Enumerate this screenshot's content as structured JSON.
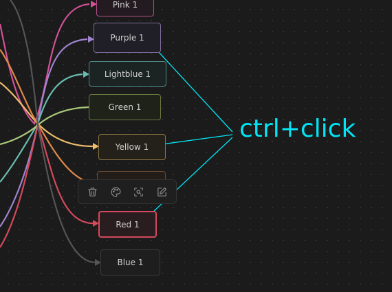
{
  "nodes": {
    "pink": {
      "label": "Pink 1",
      "color": "#d35296"
    },
    "purple": {
      "label": "Purple 1",
      "color": "#a084d0"
    },
    "lightblue": {
      "label": "Lightblue 1",
      "color": "#6bbdb1"
    },
    "green": {
      "label": "Green 1",
      "color": "#a8c878"
    },
    "yellow": {
      "label": "Yellow 1",
      "color": "#eebd6e"
    },
    "orange": {
      "label": "",
      "color": "#e08a4a"
    },
    "red": {
      "label": "Red 1",
      "color": "#d44a5c"
    },
    "blue": {
      "label": "Blue 1",
      "color": "#555555"
    }
  },
  "toolbar": {
    "icons": [
      "trash-icon",
      "palette-icon",
      "focus-icon",
      "edit-icon"
    ]
  },
  "annotation": {
    "text": "ctrl+click",
    "color": "#00e5f5"
  }
}
